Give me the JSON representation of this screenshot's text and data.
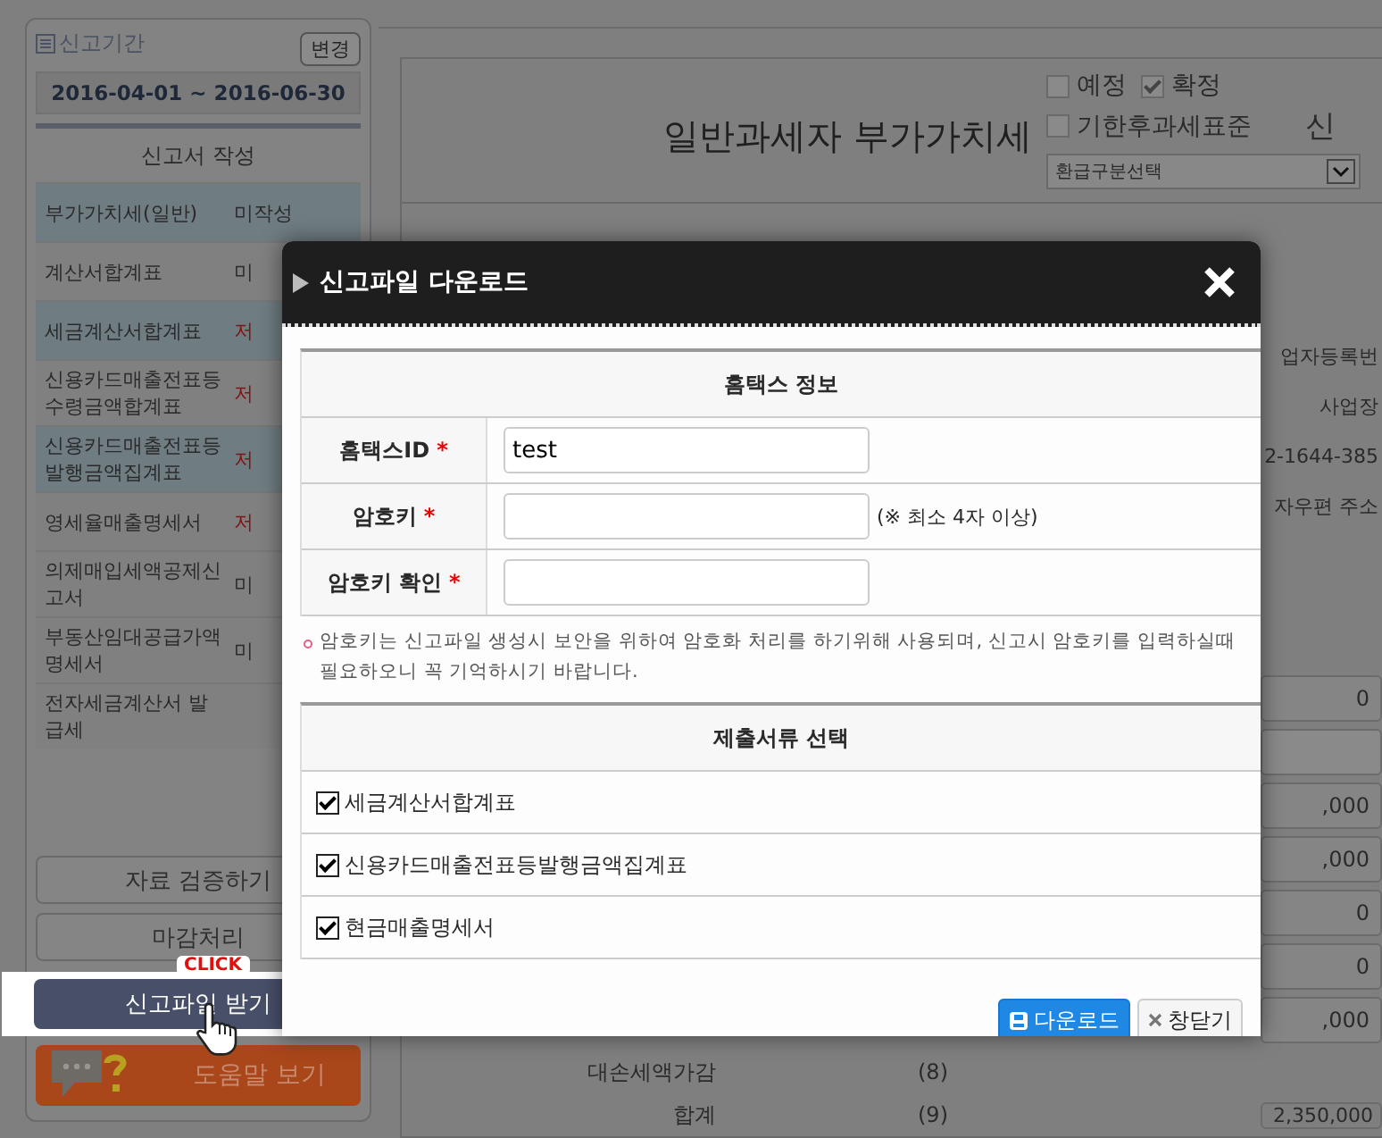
{
  "sidebar": {
    "period_label": "신고기간",
    "change_button": "변경",
    "period": "2016-04-01 ~ 2016-06-30",
    "section_title": "신고서 작성",
    "forms": [
      {
        "name": "부가가치세(일반)",
        "status": "미작성",
        "color": "#2a2a2a",
        "highlighted": true
      },
      {
        "name": "계산서합계표",
        "status": "미",
        "color": "#2a2a2a",
        "highlighted": false
      },
      {
        "name": "세금계산서합계표",
        "status": "저",
        "color": "#7e1414",
        "highlighted": true
      },
      {
        "name": "신용카드매출전표등수령금액합계표",
        "status": "저",
        "color": "#7e1414",
        "highlighted": false
      },
      {
        "name": "신용카드매출전표등발행금액집계표",
        "status": "저",
        "color": "#7e1414",
        "highlighted": true
      },
      {
        "name": "영세율매출명세서",
        "status": "저",
        "color": "#7e1414",
        "highlighted": false
      },
      {
        "name": "의제매입세액공제신고서",
        "status": "미",
        "color": "#2a2a2a",
        "highlighted": false
      },
      {
        "name": "부동산임대공급가액명세서",
        "status": "미",
        "color": "#2a2a2a",
        "highlighted": false
      },
      {
        "name": "전자세금계산서 발급세",
        "highlighted": false
      }
    ],
    "buttons": [
      {
        "label": "자료 검증하기",
        "kind": "plain"
      },
      {
        "label": "마감처리",
        "kind": "plain"
      },
      {
        "label": "신고파일 받기",
        "kind": "primary"
      }
    ],
    "click_tooltip": "CLICK",
    "help_button": "도움말 보기"
  },
  "main": {
    "title": "일반과세자 부가가치세",
    "options": [
      {
        "label": "예정",
        "checked": false
      },
      {
        "label": "확정",
        "checked": true
      },
      {
        "label": "기한후과세표준",
        "checked": false
      }
    ],
    "refund_select": "환급구분선택",
    "cut_heading": "신",
    "info_cells": [
      "업자등록번",
      "사업장",
      "2-1644-385",
      "자우편 주소"
    ],
    "amounts": [
      {
        "value": "0"
      },
      {
        "blank": true
      },
      {
        "value": ",000"
      },
      {
        "value": ",000"
      },
      {
        "value": "0"
      },
      {
        "value": "0"
      },
      {
        "value": ",000"
      }
    ],
    "rows": [
      {
        "label": "대손세액가감",
        "number": "(8)"
      },
      {
        "label": "합계",
        "number": "(9)",
        "amount": "2,350,000"
      }
    ]
  },
  "dialog": {
    "title": "신고파일 다운로드",
    "section_1": "홈택스 정보",
    "fields": [
      {
        "label": "홈택스ID",
        "required_mark": "*",
        "value": "test"
      },
      {
        "label": "암호키",
        "required_mark": "*",
        "hint": "(※ 최소 4자 이상)"
      },
      {
        "label": "암호키 확인",
        "required_mark": "*"
      }
    ],
    "note": "암호키는 신고파일 생성시 보안을 위하여 암호화 처리를 하기위해 사용되며, 신고시 암호키를 입력하실때 필요하오니 꼭 기억하시기 바랍니다.",
    "section_2": "제출서류 선택",
    "documents": [
      {
        "label": "세금계산서합계표",
        "checked": true
      },
      {
        "label": "신용카드매출전표등발행금액집계표",
        "checked": true
      },
      {
        "label": "현금매출명세서",
        "checked": true
      }
    ],
    "download_button": "다운로드",
    "close_button": "창닫기"
  }
}
